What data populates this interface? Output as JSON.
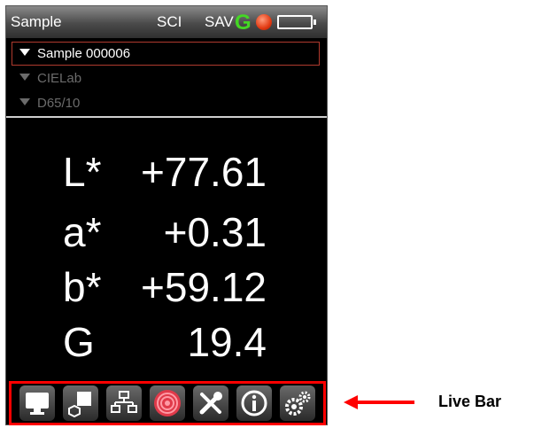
{
  "status_bar": {
    "title": "Sample",
    "mode": "SCI",
    "sav": "SAV",
    "gloss_indicator": "G",
    "icons": [
      "gloss-g-icon",
      "record-icon",
      "battery-icon"
    ]
  },
  "selectors": [
    {
      "label": "Sample 000006",
      "selected": true
    },
    {
      "label": "CIELab",
      "selected": false
    },
    {
      "label": "D65/10",
      "selected": false
    }
  ],
  "readings": [
    {
      "label": "L*",
      "value": "+77.61"
    },
    {
      "label": "a*",
      "value": "+0.31"
    },
    {
      "label": "b*",
      "value": "+59.12"
    },
    {
      "label": "G",
      "value": "19.4"
    }
  ],
  "live_bar": {
    "label": "Live Bar",
    "buttons": [
      "monitor-icon",
      "shapes-icon",
      "hierarchy-icon",
      "target-icon",
      "tools-icon",
      "info-icon",
      "settings-gears-icon"
    ],
    "accent_color": "#ff0000"
  }
}
